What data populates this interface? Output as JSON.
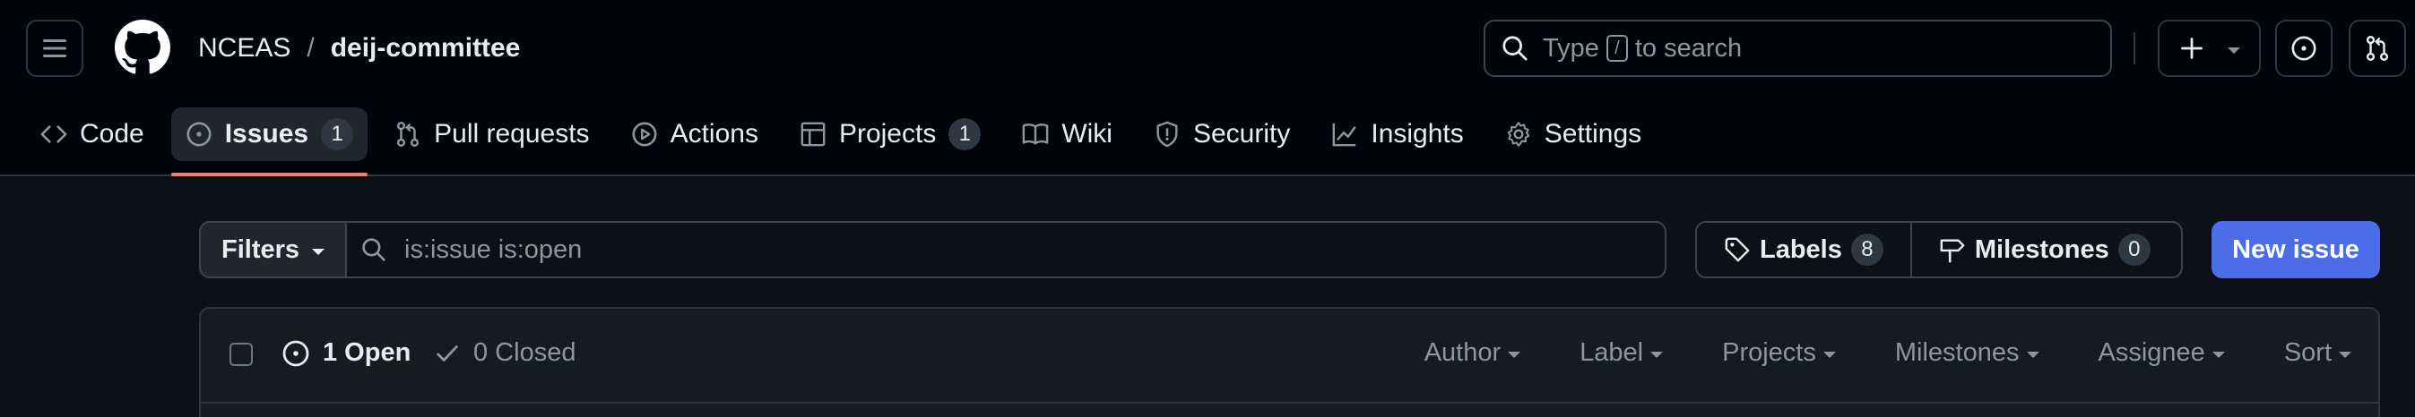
{
  "header": {
    "owner": "NCEAS",
    "separator": "/",
    "repo": "deij-committee",
    "search": {
      "prefix": "Type",
      "key": "/",
      "suffix": "to search"
    }
  },
  "tabs": [
    {
      "label": "Code",
      "icon": "code-icon"
    },
    {
      "label": "Issues",
      "icon": "issue-opened-icon",
      "count": "1",
      "active": true
    },
    {
      "label": "Pull requests",
      "icon": "git-pull-request-icon"
    },
    {
      "label": "Actions",
      "icon": "play-icon"
    },
    {
      "label": "Projects",
      "icon": "table-icon",
      "count": "1"
    },
    {
      "label": "Wiki",
      "icon": "book-icon"
    },
    {
      "label": "Security",
      "icon": "shield-icon"
    },
    {
      "label": "Insights",
      "icon": "graph-icon"
    },
    {
      "label": "Settings",
      "icon": "gear-icon"
    }
  ],
  "filterbar": {
    "filters_label": "Filters",
    "query_value": "",
    "query_placeholder": "is:issue is:open",
    "labels_label": "Labels",
    "labels_count": "8",
    "milestones_label": "Milestones",
    "milestones_count": "0",
    "new_issue_label": "New issue"
  },
  "issues": {
    "open_label": "1 Open",
    "closed_label": "0 Closed",
    "sorters": [
      "Author",
      "Label",
      "Projects",
      "Milestones",
      "Assignee",
      "Sort"
    ]
  },
  "colors": {
    "accent": "#f78166",
    "primary_button": "#4c6ce8",
    "background": "#0d1117",
    "header_background": "#010409"
  }
}
